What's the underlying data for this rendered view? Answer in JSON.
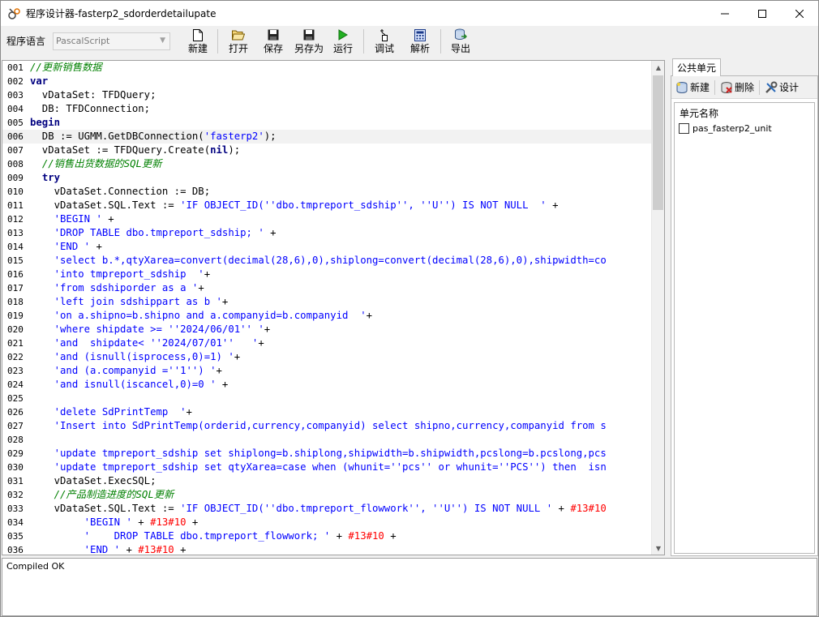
{
  "window": {
    "title": "程序设计器-fasterp2_sdorderdetailupate"
  },
  "toolbar": {
    "language_label": "程序语言",
    "language_value": "PascalScript",
    "buttons": {
      "new": "新建",
      "open": "打开",
      "save": "保存",
      "save_as": "另存为",
      "run": "运行",
      "debug": "调试",
      "parse": "解析",
      "export": "导出"
    }
  },
  "editor": {
    "lines": [
      {
        "n": "001",
        "t": "//更新销售数据"
      },
      {
        "n": "002",
        "t": "var"
      },
      {
        "n": "003",
        "t": "  vDataSet: TFDQuery;"
      },
      {
        "n": "004",
        "t": "  DB: TFDConnection;"
      },
      {
        "n": "005",
        "t": "begin"
      },
      {
        "n": "006",
        "t": "  DB := UGMM.GetDBConnection('fasterp2');"
      },
      {
        "n": "007",
        "t": "  vDataSet := TFDQuery.Create(nil);"
      },
      {
        "n": "008",
        "t": "  //销售出货数据的SQL更新"
      },
      {
        "n": "009",
        "t": "  try"
      },
      {
        "n": "010",
        "t": "    vDataSet.Connection := DB;"
      },
      {
        "n": "011",
        "t": "    vDataSet.SQL.Text := 'IF OBJECT_ID(''dbo.tmpreport_sdship'', ''U'') IS NOT NULL  ' +"
      },
      {
        "n": "012",
        "t": "    'BEGIN ' +"
      },
      {
        "n": "013",
        "t": "    'DROP TABLE dbo.tmpreport_sdship; ' +"
      },
      {
        "n": "014",
        "t": "    'END ' +"
      },
      {
        "n": "015",
        "t": "    'select b.*,qtyXarea=convert(decimal(28,6),0),shiplong=convert(decimal(28,6),0),shipwidth=co"
      },
      {
        "n": "016",
        "t": "    'into tmpreport_sdship  '+"
      },
      {
        "n": "017",
        "t": "    'from sdshiporder as a '+"
      },
      {
        "n": "018",
        "t": "    'left join sdshippart as b '+"
      },
      {
        "n": "019",
        "t": "    'on a.shipno=b.shipno and a.companyid=b.companyid  '+"
      },
      {
        "n": "020",
        "t": "    'where shipdate >= ''2024/06/01'' '+"
      },
      {
        "n": "021",
        "t": "    'and  shipdate< ''2024/07/01''   '+"
      },
      {
        "n": "022",
        "t": "    'and (isnull(isprocess,0)=1) '+"
      },
      {
        "n": "023",
        "t": "    'and (a.companyid =''1'') '+"
      },
      {
        "n": "024",
        "t": "    'and isnull(iscancel,0)=0 ' +"
      },
      {
        "n": "025",
        "t": ""
      },
      {
        "n": "026",
        "t": "    'delete SdPrintTemp  '+"
      },
      {
        "n": "027",
        "t": "    'Insert into SdPrintTemp(orderid,currency,companyid) select shipno,currency,companyid from s"
      },
      {
        "n": "028",
        "t": ""
      },
      {
        "n": "029",
        "t": "    'update tmpreport_sdship set shiplong=b.shiplong,shipwidth=b.shipwidth,pcslong=b.pcslong,pcs"
      },
      {
        "n": "030",
        "t": "    'update tmpreport_sdship set qtyXarea=case when (whunit=''pcs'' or whunit=''PCS'') then  isn"
      },
      {
        "n": "031",
        "t": "    vDataSet.ExecSQL;"
      },
      {
        "n": "032",
        "t": "    //产品制造进度的SQL更新"
      },
      {
        "n": "033",
        "t": "    vDataSet.SQL.Text := 'IF OBJECT_ID(''dbo.tmpreport_flowwork'', ''U'') IS NOT NULL ' + #13#10"
      },
      {
        "n": "034",
        "t": "         'BEGIN ' + #13#10 +"
      },
      {
        "n": "035",
        "t": "         '    DROP TABLE dbo.tmpreport_flowwork; ' + #13#10 +"
      },
      {
        "n": "036",
        "t": "         'END ' + #13#10 +"
      }
    ]
  },
  "right_panel": {
    "tab": "公共单元",
    "new_label": "新建",
    "delete_label": "删除",
    "design_label": "设计",
    "list_header": "单元名称",
    "items": [
      "pas_fasterp2_unit"
    ]
  },
  "status": {
    "message": "Compiled OK"
  }
}
